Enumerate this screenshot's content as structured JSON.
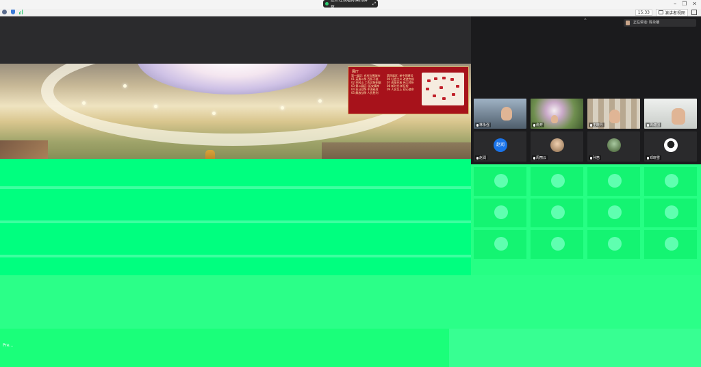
{
  "share_banner": {
    "text": "您正在观看陈某的屏幕"
  },
  "toolbar": {
    "time": "15:33",
    "view_label": "演讲者视图"
  },
  "speaker": {
    "label": "正在讲话: 陈永娥"
  },
  "map_panel": {
    "title": "展厅",
    "col1": [
      "第一展区: 农村包围城市",
      "01 英勇斗争 百折不挠",
      "02 井冈山 工农武装割据",
      "03 第二展区: 延安精神",
      "04 抗日战争 中流砥柱",
      "05 解放战争 人民胜利"
    ],
    "col2": [
      "第四展区: 新中国建设",
      "06 社会主义 改造完成",
      "07 改革开放 伟大转折",
      "08 新时代 新征程",
      "09 人民至上 初心使命"
    ]
  },
  "participants": [
    {
      "name": "林永强",
      "kind": "video",
      "color": "#7a8a9c"
    },
    {
      "name": "俞开",
      "kind": "video",
      "color": "#8aa66e"
    },
    {
      "name": "王晓丹",
      "kind": "video",
      "color": "#b8b2a6"
    },
    {
      "name": "周建国",
      "kind": "video",
      "color": "#d8dcd8"
    },
    {
      "name": "赵润",
      "kind": "avatar",
      "avatar_text": "赵润"
    },
    {
      "name": "周丽云",
      "kind": "avatar-photo",
      "color": "#c9a58a"
    },
    {
      "name": "孙笛",
      "kind": "avatar-photo",
      "color": "#6b8a5a"
    },
    {
      "name": "邓晓雪",
      "kind": "avatar-photo",
      "color": "#eeeeee"
    }
  ],
  "bottom_label": "Pre..."
}
